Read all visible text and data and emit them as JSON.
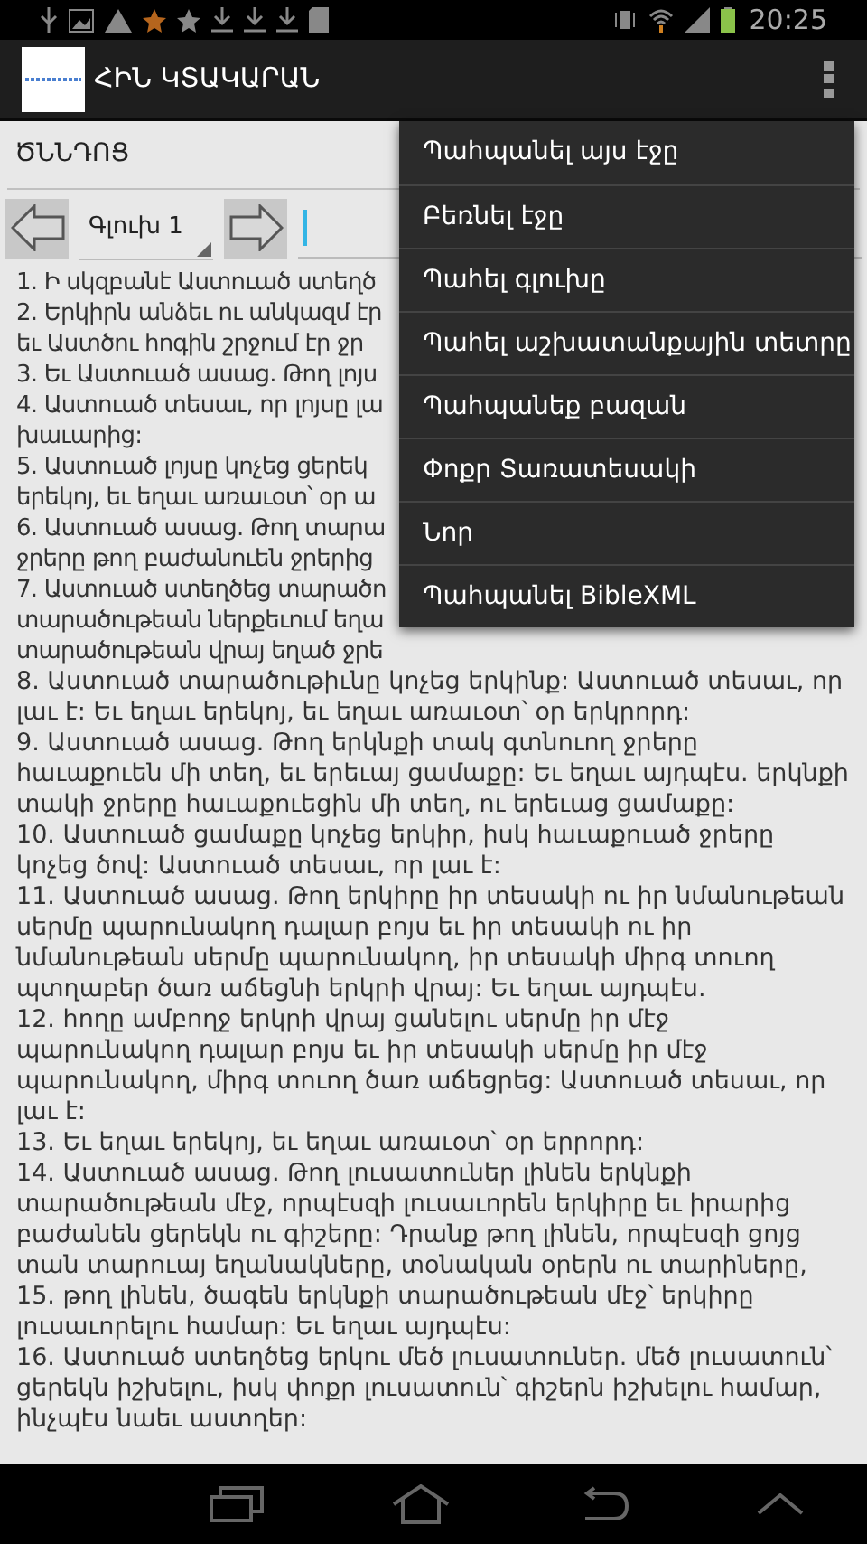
{
  "status_bar": {
    "time": "20:25"
  },
  "action_bar": {
    "title": "ՀԻՆ ԿՏԱԿԱՐԱՆ"
  },
  "book": {
    "value": "ԾՆՆԴՈՑ"
  },
  "navigation": {
    "chapter": "Գլուխ 1"
  },
  "covered_lines": [
    "1. Ի սկզբանէ Աստուած ստեղծ",
    "2. Երկիրն անձեւ ու անկազմ էր",
    "եւ Աստծու հոգին շրջում էր ջր",
    "3. Եւ Աստուած ասաց. Թող լոյս",
    "4. Աստուած տեսաւ, որ լոյսը լա",
    "խաւարից:",
    "5. Աստուած լոյսը կոչեց ցերեկ",
    "երեկոյ, եւ եղաւ առաւօտ՝ օր ա",
    "6. Աստուած ասաց. Թող տարա",
    "ջրերը թող բաժանուեն ջրերից",
    "7. Աստուած ստեղծեց տարածո",
    "տարածութեան ներքեւում եղա",
    "տարածութեան վրայ եղած ջրե"
  ],
  "verses": [
    "8. Աստուած տարածութիւնը կոչեց երկինք: Աստուած տեսաւ, որ լաւ է: Եւ եղաւ երեկոյ, եւ եղաւ առաւօտ՝ օր երկրորդ:",
    "9. Աստուած ասաց. Թող երկնքի տակ գտնուող ջրերը հաւաքուեն մի տեղ, եւ երեւայ ցամաքը: Եւ եղաւ այդպէս. երկնքի տակի ջրերը հաւաքուեցին մի տեղ, ու երեւաց ցամաքը:",
    "10. Աստուած ցամաքը կոչեց երկիր, իսկ հաւաքուած ջրերը կոչեց ծով: Աստուած տեսաւ, որ լաւ է:",
    "11. Աստուած ասաց. Թող երկիրը իր տեսակի ու իր նմանութեան սերմը պարունակող դալար բոյս եւ իր տեսակի ու իր նմանութեան սերմը պարունակող, իր տեսակի միրգ տուող պտղաբեր ծառ աճեցնի երկրի վրայ: Եւ եղաւ այդպէս.",
    "12. հողը ամբողջ երկրի վրայ ցանելու սերմը իր մէջ պարունակող դալար բոյս եւ իր տեսակի սերմը իր մէջ պարունակող, միրգ տուող ծառ աճեցրեց: Աստուած տեսաւ, որ լաւ է:",
    "13. Եւ եղաւ երեկոյ, եւ եղաւ առաւօտ՝ օր երրորդ:",
    "14. Աստուած ասաց. Թող լուսատուներ լինեն երկնքի տարածութեան մէջ, որպէսզի լուսաւորեն երկիրը եւ իրարից բաժանեն ցերեկն ու գիշերը: Դրանք թող լինեն, որպէսզի ցոյց տան տարուայ եղանակները, տօնական օրերն ու տարիները,",
    "15. թող լինեն, ծագեն երկնքի տարածութեան մէջ՝ երկիրը լուսաւորելու համար: Եւ եղաւ այդպէս:",
    "16. Աստուած ստեղծեց երկու մեծ լուսատուներ. մեծ լուսատուն՝ ցերեկն իշխելու, իսկ փոքր լուսատուն՝ գիշերն իշխելու համար, ինչպէս նաեւ աստղեր:"
  ],
  "menu": [
    "Պահպանել այս էջը",
    "Բեռնել էջը",
    "Պահել գլուխը",
    "Պահել աշխատանքային տետրը",
    "Պահպանեք բազան",
    "Փոքր Տառատեսակի",
    "Նոր",
    "Պահպանել BibleXML"
  ]
}
